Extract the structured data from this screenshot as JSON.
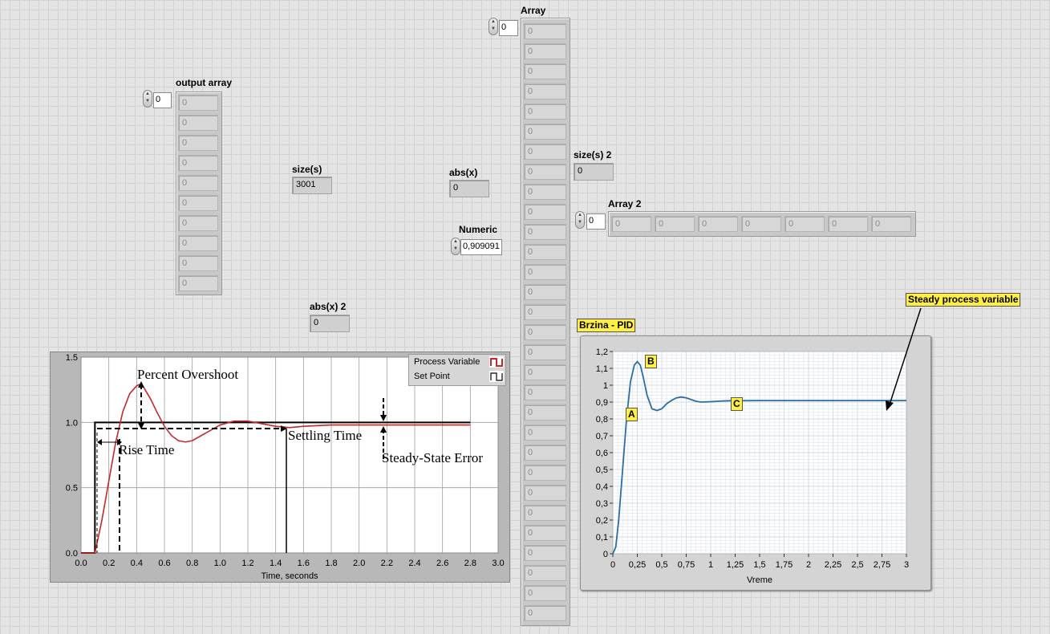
{
  "output_array": {
    "label": "output array",
    "index": "0",
    "values": [
      "0",
      "0",
      "0",
      "0",
      "0",
      "0",
      "0",
      "0",
      "0",
      "0"
    ]
  },
  "size_s": {
    "label": "size(s)",
    "value": "3001"
  },
  "abs_x": {
    "label": "abs(x)",
    "value": "0"
  },
  "numeric": {
    "label": "Numeric",
    "value": "0,909091"
  },
  "abs_x2": {
    "label": "abs(x) 2",
    "value": "0"
  },
  "array": {
    "label": "Array",
    "index": "0",
    "values": [
      "0",
      "0",
      "0",
      "0",
      "0",
      "0",
      "0",
      "0",
      "0",
      "0",
      "0",
      "0",
      "0",
      "0",
      "0",
      "0",
      "0",
      "0",
      "0",
      "0",
      "0",
      "0",
      "0",
      "0",
      "0",
      "0",
      "0",
      "0",
      "0",
      "0"
    ]
  },
  "size_s2": {
    "label": "size(s) 2",
    "value": "0"
  },
  "array2": {
    "label": "Array 2",
    "index": "0",
    "values": [
      "0",
      "0",
      "0",
      "0",
      "0",
      "0",
      "0"
    ]
  },
  "legend": {
    "process_variable": "Process Variable",
    "set_point": "Set Point"
  },
  "annotations": {
    "percent_overshoot": "Percent Overshoot",
    "rise_time": "Rise Time",
    "settling_time": "Settling Time",
    "steady_state_error": "Steady-State Error",
    "steady_process_variable": "Steady process variable",
    "point_a": "A",
    "point_b": "B",
    "point_c": "C"
  },
  "colors": {
    "process_variable": "#c62828",
    "set_point": "#000000",
    "pid_curve": "#2e6da4",
    "tag": "#ffef42"
  },
  "chart_data": [
    {
      "type": "line",
      "title": "",
      "xlabel": "Time, seconds",
      "ylabel": "",
      "xlim": [
        0.0,
        3.0
      ],
      "ylim": [
        0.0,
        1.5
      ],
      "xticks": [
        "0.0",
        "0.2",
        "0.4",
        "0.6",
        "0.8",
        "1.0",
        "1.2",
        "1.4",
        "1.6",
        "1.8",
        "2.0",
        "2.2",
        "2.4",
        "2.6",
        "2.8",
        "3.0"
      ],
      "yticks": [
        "0.0",
        "0.5",
        "1.0",
        "1.5"
      ],
      "grid": true,
      "legend_position": "top-right",
      "series": [
        {
          "name": "Process Variable",
          "x": [
            0,
            0.1,
            0.15,
            0.2,
            0.25,
            0.3,
            0.35,
            0.4,
            0.42,
            0.45,
            0.5,
            0.55,
            0.6,
            0.65,
            0.7,
            0.75,
            0.8,
            0.9,
            1.0,
            1.1,
            1.2,
            1.3,
            1.4,
            1.5,
            1.6,
            1.8,
            2.0,
            2.2,
            2.4,
            2.6,
            2.8
          ],
          "y": [
            0,
            0,
            0.25,
            0.55,
            0.85,
            1.08,
            1.22,
            1.28,
            1.29,
            1.27,
            1.18,
            1.07,
            0.97,
            0.9,
            0.86,
            0.85,
            0.86,
            0.92,
            0.98,
            1.01,
            1.01,
            0.99,
            0.97,
            0.96,
            0.97,
            0.98,
            0.98,
            0.98,
            0.98,
            0.98,
            0.98
          ]
        },
        {
          "name": "Set Point",
          "x": [
            0,
            0.1,
            0.1,
            2.8
          ],
          "y": [
            0,
            0,
            1,
            1
          ]
        }
      ]
    },
    {
      "type": "line",
      "title": "Brzina - PID",
      "xlabel": "Vreme",
      "ylabel": "",
      "xlim": [
        0,
        3
      ],
      "ylim": [
        0,
        1.2
      ],
      "xticks": [
        "0",
        "0,25",
        "0,5",
        "0,75",
        "1",
        "1,25",
        "1,5",
        "1,75",
        "2",
        "2,25",
        "2,5",
        "2,75",
        "3"
      ],
      "yticks": [
        "0",
        "0,1",
        "0,2",
        "0,3",
        "0,4",
        "0,5",
        "0,6",
        "0,7",
        "0,8",
        "0,9",
        "1",
        "1,1",
        "1,2"
      ],
      "grid": true,
      "series": [
        {
          "x": [
            0,
            0.03,
            0.06,
            0.1,
            0.14,
            0.18,
            0.22,
            0.25,
            0.28,
            0.31,
            0.35,
            0.4,
            0.45,
            0.5,
            0.55,
            0.6,
            0.65,
            0.7,
            0.75,
            0.8,
            0.85,
            0.9,
            1.0,
            1.1,
            1.2,
            1.5,
            2,
            2.5,
            3
          ],
          "y": [
            0,
            0.04,
            0.2,
            0.5,
            0.8,
            1.02,
            1.12,
            1.14,
            1.12,
            1.05,
            0.94,
            0.86,
            0.85,
            0.86,
            0.89,
            0.91,
            0.925,
            0.93,
            0.925,
            0.915,
            0.905,
            0.9,
            0.902,
            0.906,
            0.908,
            0.909,
            0.909,
            0.909,
            0.909
          ]
        }
      ]
    }
  ]
}
